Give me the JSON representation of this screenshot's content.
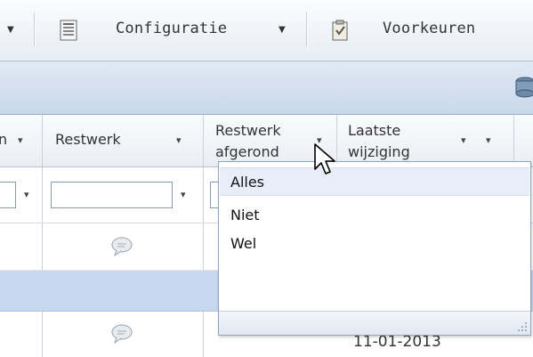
{
  "toolbar": {
    "configuratie_label": "Configuratie",
    "voorkeuren_label": "Voorkeuren"
  },
  "columns": {
    "prev_label": "n",
    "restwerk_label": "Restwerk",
    "afgerond_label_line1": "Restwerk",
    "afgerond_label_line2": "afgerond",
    "laatste_label_line1": "Laatste",
    "laatste_label_line2": "wijziging"
  },
  "rows": [
    {
      "date": ""
    },
    {
      "date": ""
    },
    {
      "date": "11-01-2013"
    }
  ],
  "dropdown": {
    "options": [
      "Alles",
      "Niet",
      "Wel"
    ],
    "selected": "Alles"
  },
  "colors": {
    "selected_row": "#c6d7ee",
    "header_bar": "#c9d8ec"
  }
}
